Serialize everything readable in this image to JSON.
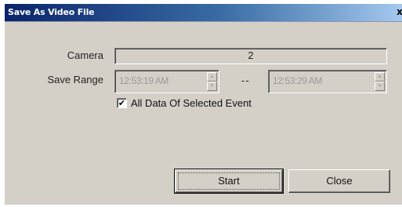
{
  "window": {
    "title": "Save As Video File",
    "close_glyph": "x"
  },
  "form": {
    "camera_label": "Camera",
    "camera_value": "2",
    "save_range_label": "Save Range",
    "range_start": "12:53:19 AM",
    "range_separator": "--",
    "range_end": "12:53:29 AM",
    "all_data_checkbox": {
      "label": "All Data Of Selected Event",
      "checked": true,
      "check_glyph": "✔"
    }
  },
  "buttons": {
    "start_label": "Start",
    "close_label": "Close"
  },
  "colors": {
    "titlebar_start": "#0a246a",
    "titlebar_end": "#a6caf0",
    "dialog_face": "#d4d0c8"
  },
  "icons": {
    "spin_up": "▲",
    "spin_down": "▼"
  }
}
